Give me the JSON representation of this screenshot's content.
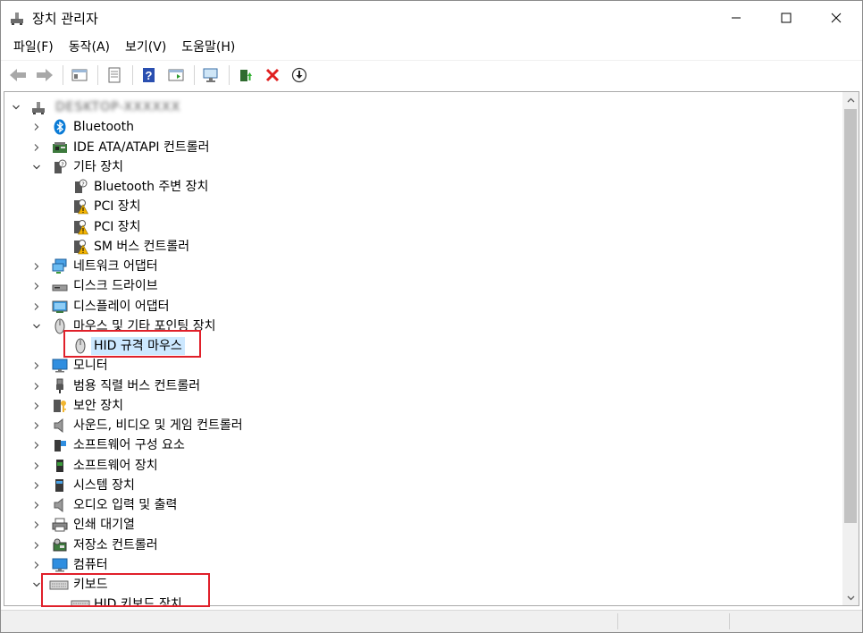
{
  "window": {
    "title": "장치 관리자",
    "icon": "device-manager-icon",
    "controls": [
      "minimize",
      "maximize",
      "close"
    ]
  },
  "menu": {
    "items": [
      {
        "label": "파일(F)"
      },
      {
        "label": "동작(A)"
      },
      {
        "label": "보기(V)"
      },
      {
        "label": "도움말(H)"
      }
    ]
  },
  "toolbar": {
    "buttons": [
      "back-arrow-icon",
      "forward-arrow-icon",
      "properties-pane-icon",
      "document-icon",
      "help-icon",
      "action-pane-icon",
      "scan-monitor-icon",
      "update-driver-icon",
      "uninstall-x-icon",
      "download-circle-icon"
    ]
  },
  "tree": {
    "root": {
      "label": "DESKTOP-XXXXXX",
      "expanded": true
    },
    "items": [
      {
        "label": "Bluetooth",
        "level": 1,
        "expanded": false,
        "icon": "bluetooth-icon"
      },
      {
        "label": "IDE ATA/ATAPI 컨트롤러",
        "level": 1,
        "expanded": false,
        "icon": "ide-controller-icon"
      },
      {
        "label": "기타 장치",
        "level": 1,
        "expanded": true,
        "icon": "unknown-device-icon"
      },
      {
        "label": "Bluetooth 주변 장치",
        "level": 2,
        "icon": "unknown-device-icon"
      },
      {
        "label": "PCI 장치",
        "level": 2,
        "icon": "warning-device-icon"
      },
      {
        "label": "PCI 장치",
        "level": 2,
        "icon": "warning-device-icon"
      },
      {
        "label": "SM 버스 컨트롤러",
        "level": 2,
        "icon": "warning-device-icon"
      },
      {
        "label": "네트워크 어댑터",
        "level": 1,
        "expanded": false,
        "icon": "network-adapter-icon"
      },
      {
        "label": "디스크 드라이브",
        "level": 1,
        "expanded": false,
        "icon": "disk-drive-icon"
      },
      {
        "label": "디스플레이 어댑터",
        "level": 1,
        "expanded": false,
        "icon": "display-adapter-icon"
      },
      {
        "label": "마우스 및 기타 포인팅 장치",
        "level": 1,
        "expanded": true,
        "icon": "mouse-icon"
      },
      {
        "label": "HID 규격 마우스",
        "level": 2,
        "icon": "mouse-icon",
        "selected": true
      },
      {
        "label": "모니터",
        "level": 1,
        "expanded": false,
        "icon": "monitor-icon"
      },
      {
        "label": "범용 직렬 버스 컨트롤러",
        "level": 1,
        "expanded": false,
        "icon": "usb-icon"
      },
      {
        "label": "보안 장치",
        "level": 1,
        "expanded": false,
        "icon": "security-key-icon"
      },
      {
        "label": "사운드, 비디오 및 게임 컨트롤러",
        "level": 1,
        "expanded": false,
        "icon": "speaker-icon"
      },
      {
        "label": "소프트웨어 구성 요소",
        "level": 1,
        "expanded": false,
        "icon": "software-component-icon"
      },
      {
        "label": "소프트웨어 장치",
        "level": 1,
        "expanded": false,
        "icon": "software-device-icon"
      },
      {
        "label": "시스템 장치",
        "level": 1,
        "expanded": false,
        "icon": "system-device-icon"
      },
      {
        "label": "오디오 입력 및 출력",
        "level": 1,
        "expanded": false,
        "icon": "speaker-icon"
      },
      {
        "label": "인쇄 대기열",
        "level": 1,
        "expanded": false,
        "icon": "printer-icon"
      },
      {
        "label": "저장소 컨트롤러",
        "level": 1,
        "expanded": false,
        "icon": "storage-controller-icon"
      },
      {
        "label": "컴퓨터",
        "level": 1,
        "expanded": false,
        "icon": "computer-icon"
      },
      {
        "label": "키보드",
        "level": 1,
        "expanded": true,
        "icon": "keyboard-icon"
      },
      {
        "label": "HID 키보드 장치",
        "level": 2,
        "icon": "keyboard-icon"
      }
    ]
  },
  "colors": {
    "selection": "#cce8ff",
    "annotation": "#e0202a",
    "warning": "#f5b400",
    "bluetooth": "#0a7bd6"
  }
}
